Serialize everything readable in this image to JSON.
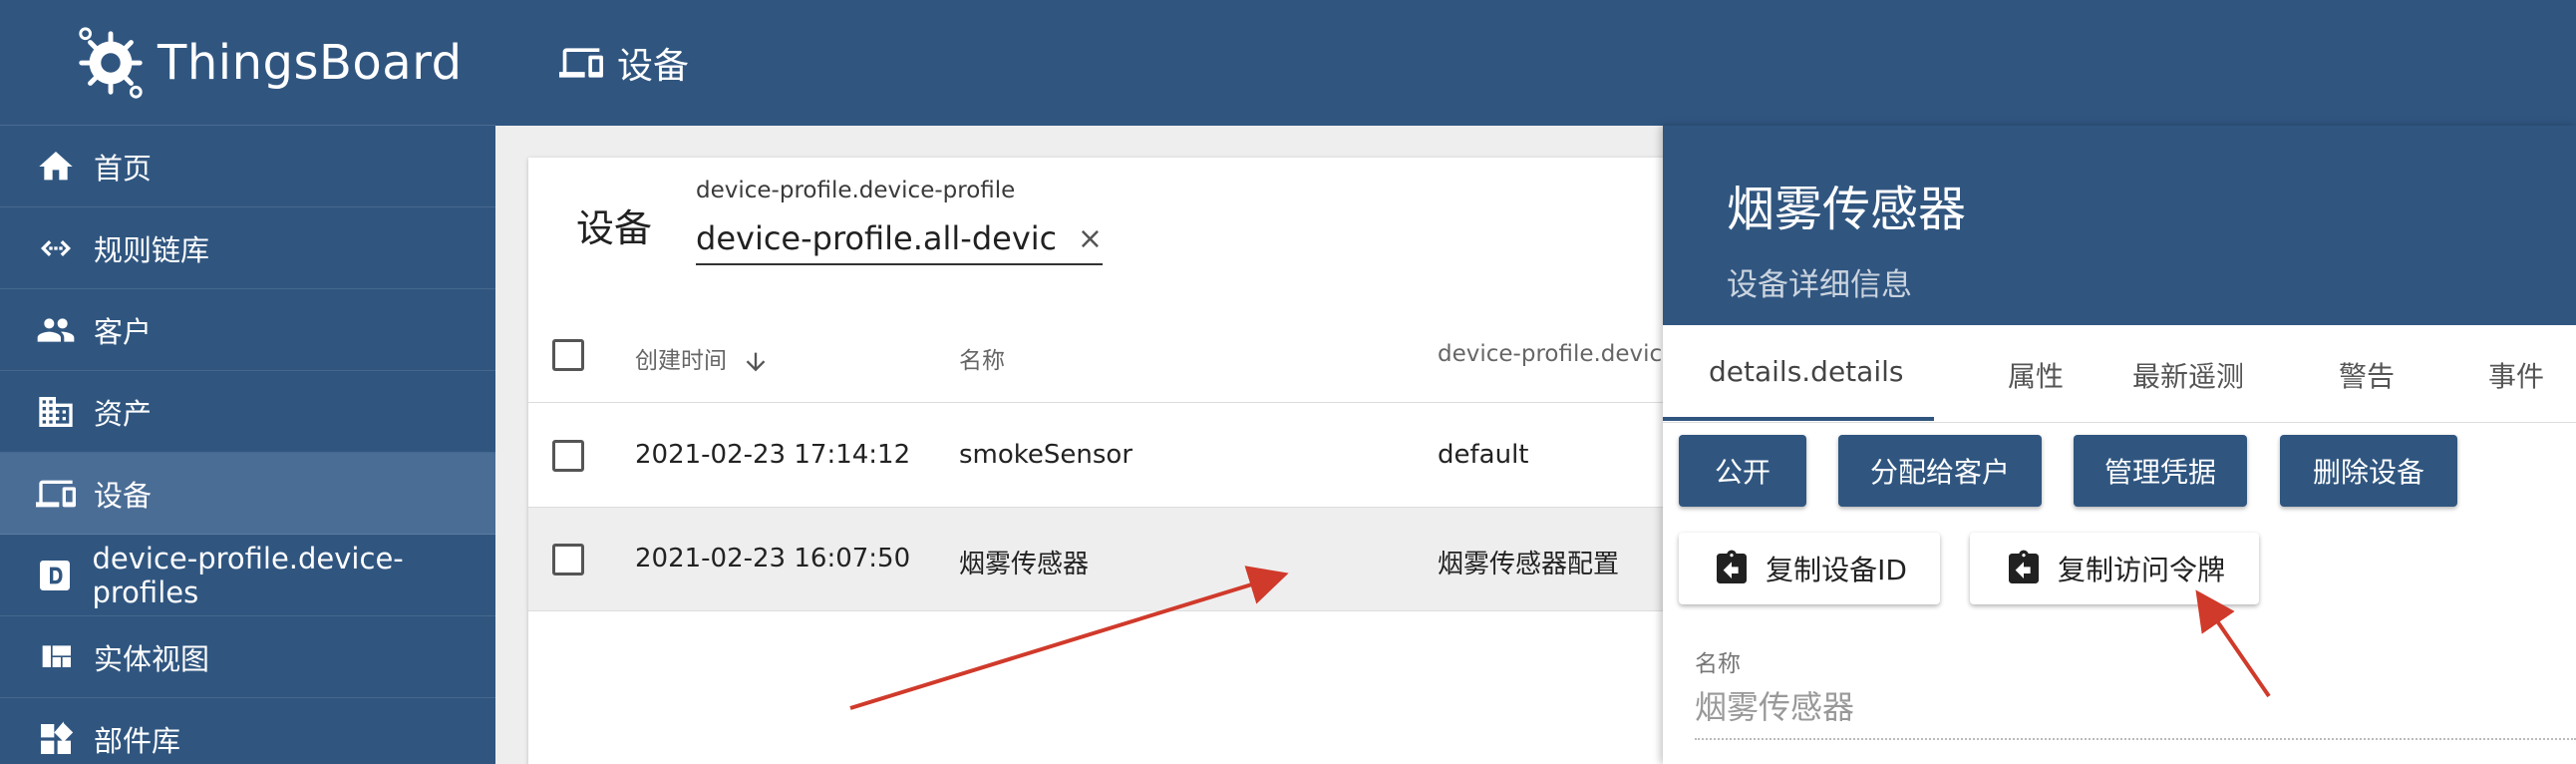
{
  "app": {
    "name": "ThingsBoard"
  },
  "sidebar": {
    "items": [
      {
        "label": "首页",
        "icon": "home-icon"
      },
      {
        "label": "规则链库",
        "icon": "code-brackets-icon"
      },
      {
        "label": "客户",
        "icon": "people-icon"
      },
      {
        "label": "资产",
        "icon": "building-icon"
      },
      {
        "label": "设备",
        "icon": "devices-icon",
        "active": true
      },
      {
        "label": "device-profile.device-profiles",
        "icon": "letter-d-icon"
      },
      {
        "label": "实体视图",
        "icon": "view-quilt-icon"
      },
      {
        "label": "部件库",
        "icon": "widgets-icon"
      }
    ]
  },
  "topbar": {
    "title": "设备"
  },
  "table": {
    "title": "设备",
    "filter": {
      "label": "device-profile.device-profile",
      "value": "device-profile.all-device-profiles",
      "clear": "×"
    },
    "columns": [
      "创建时间",
      "名称",
      "device-profile.device-profile"
    ],
    "sort_icon": "arrow-down-icon",
    "rows": [
      {
        "created": "2021-02-23 17:14:12",
        "name": "smokeSensor",
        "profile": "default"
      },
      {
        "created": "2021-02-23 16:07:50",
        "name": "烟雾传感器",
        "profile": "烟雾传感器配置"
      }
    ]
  },
  "details": {
    "title": "烟雾传感器",
    "subtitle": "设备详细信息",
    "tabs": [
      "details.details",
      "属性",
      "最新遥测",
      "警告",
      "事件"
    ],
    "actions": [
      "公开",
      "分配给客户",
      "管理凭据",
      "删除设备"
    ],
    "copy_buttons": [
      "复制设备ID",
      "复制访问令牌"
    ],
    "name_field": {
      "label": "名称",
      "value": "烟雾传感器"
    }
  },
  "annotation_color": "#d03a2b"
}
